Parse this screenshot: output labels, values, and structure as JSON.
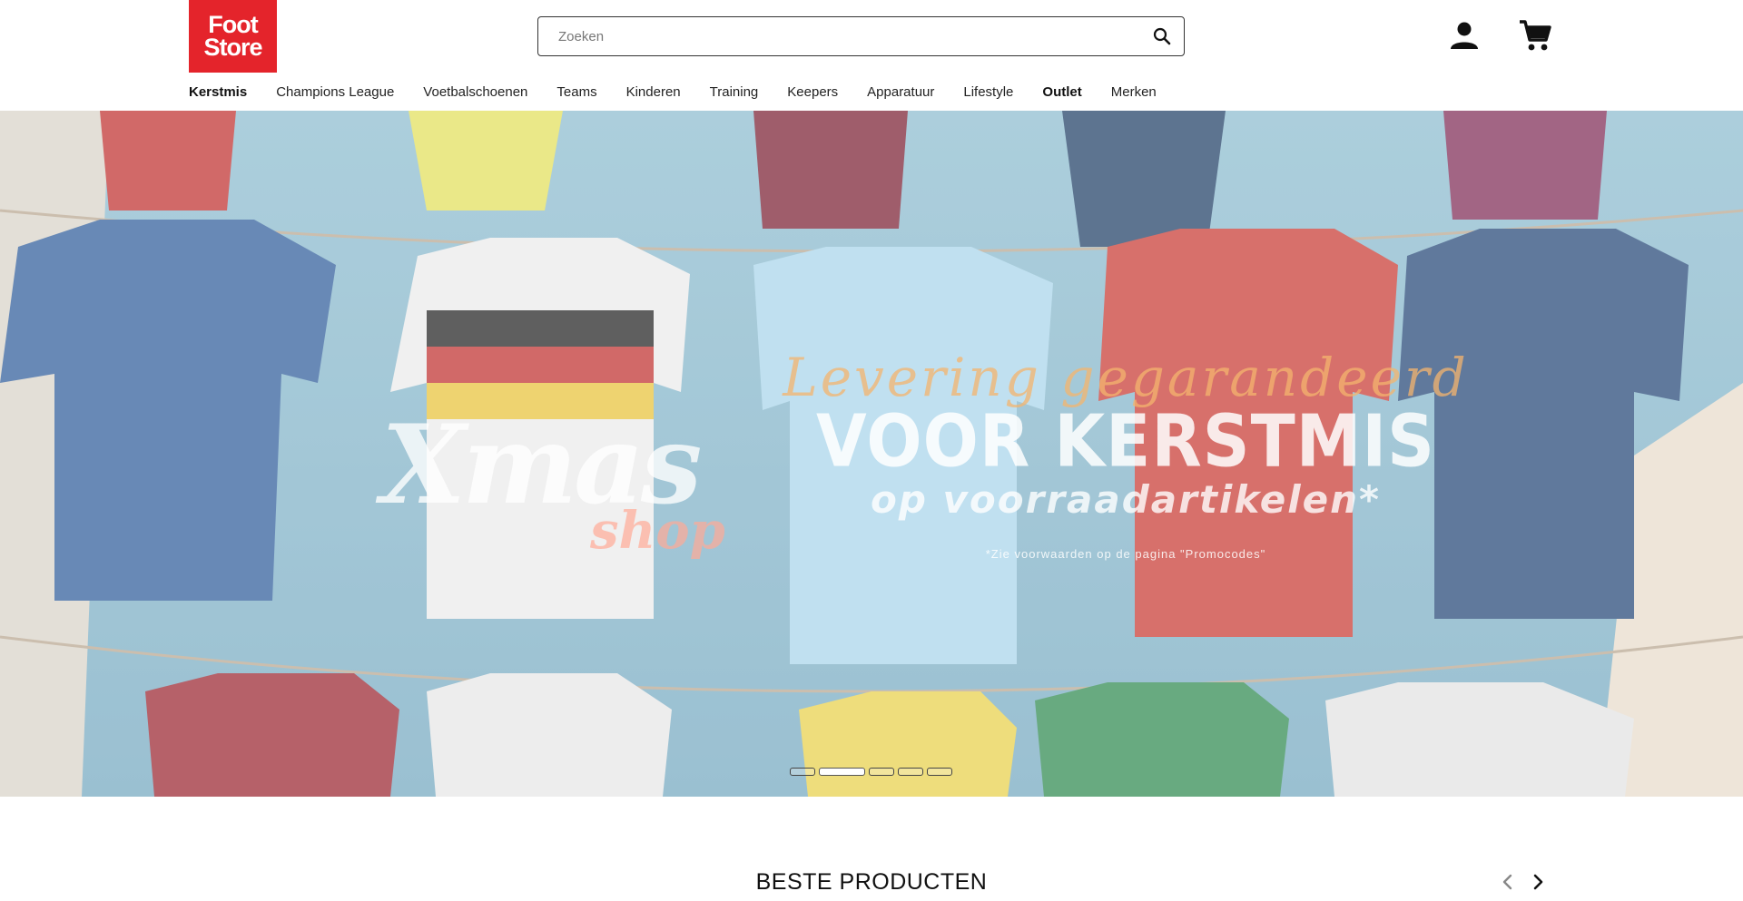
{
  "header": {
    "logo_line1": "Foot",
    "logo_line2": "Store",
    "search": {
      "placeholder": "Zoeken",
      "value": ""
    },
    "icons": [
      "search-icon",
      "user-icon",
      "cart-icon"
    ]
  },
  "nav": {
    "items": [
      {
        "label": "Kerstmis",
        "bold": true
      },
      {
        "label": "Champions League",
        "bold": false
      },
      {
        "label": "Voetbalschoenen",
        "bold": false
      },
      {
        "label": "Teams",
        "bold": false
      },
      {
        "label": "Kinderen",
        "bold": false
      },
      {
        "label": "Training",
        "bold": false
      },
      {
        "label": "Keepers",
        "bold": false
      },
      {
        "label": "Apparatuur",
        "bold": false
      },
      {
        "label": "Lifestyle",
        "bold": false
      },
      {
        "label": "Outlet",
        "bold": true
      },
      {
        "label": "Merken",
        "bold": false
      }
    ]
  },
  "hero": {
    "brand_word": "Xmas",
    "brand_sub": "shop",
    "line1": "Levering gegarandeerd",
    "line2": "VOOR KERSTMIS",
    "line3": "op voorraadartikelen*",
    "note": "*Zie voorwaarden op de pagina \"Promocodes\"",
    "slides_total": 5,
    "active_slide": 2
  },
  "section": {
    "title": "BESTE PRODUCTEN"
  },
  "colors": {
    "brand_red": "#e4242b",
    "text": "#111111",
    "hero_sky": "#7fb0c7"
  }
}
